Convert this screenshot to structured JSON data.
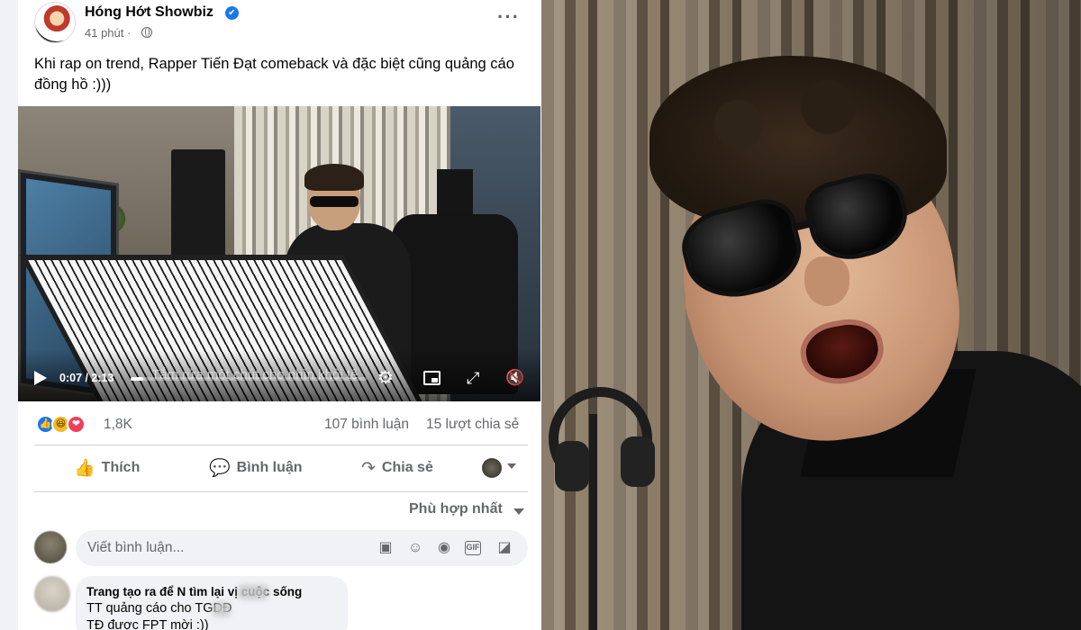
{
  "post": {
    "page_name": "Hóng Hớt Showbiz",
    "verified_glyph": "✔",
    "time": "41 phút ·",
    "more_glyph": "···",
    "caption": "Khi rap on trend, Rapper Tiến Đạt comeback và đặc biệt cũng quảng cáo đồng hồ :)))"
  },
  "video": {
    "time_display": "0:07 / 2:13",
    "progress_fraction": 0.053,
    "subtitle_text": "Tắm rửa một chút cho nhìn khỏi tệ",
    "settings_glyph": "⚙",
    "expand_glyph": "⤢",
    "mute_glyph": "🔇"
  },
  "stats": {
    "reactions": [
      {
        "name": "like-icon",
        "glyph": "👍",
        "color": "#1877f2"
      },
      {
        "name": "haha-icon",
        "glyph": "😆",
        "color": "#f7b928"
      },
      {
        "name": "love-icon",
        "glyph": "❤",
        "color": "#f33e58"
      }
    ],
    "reaction_count": "1,8K",
    "comments": "107 bình luận",
    "shares": "15 lượt chia sẻ"
  },
  "actions": {
    "like_label": "Thích",
    "like_glyph": "👍",
    "comment_label": "Bình luận",
    "comment_glyph": "💬",
    "share_label": "Chia sẻ",
    "share_glyph": "↷"
  },
  "comments_section": {
    "sort_label": "Phù hợp nhất",
    "input_placeholder": "Viết bình luận...",
    "input_icons": {
      "sticker_glyph": "▣",
      "emoji_glyph": "☺",
      "camera_glyph": "◉",
      "gif_label": "GIF",
      "sticker2_glyph": "◪"
    },
    "first_comment": {
      "line1": "Trang tạo ra để N tìm lại     vị cuộc sống",
      "line2": "TT quảng cáo cho TGDĐ",
      "line3": "TĐ được FPT mời :))"
    }
  },
  "colors": {
    "brand_blue": "#1877f2",
    "secondary_text": "#65676b",
    "divider": "#ced0d4",
    "input_bg": "#f0f2f5"
  }
}
